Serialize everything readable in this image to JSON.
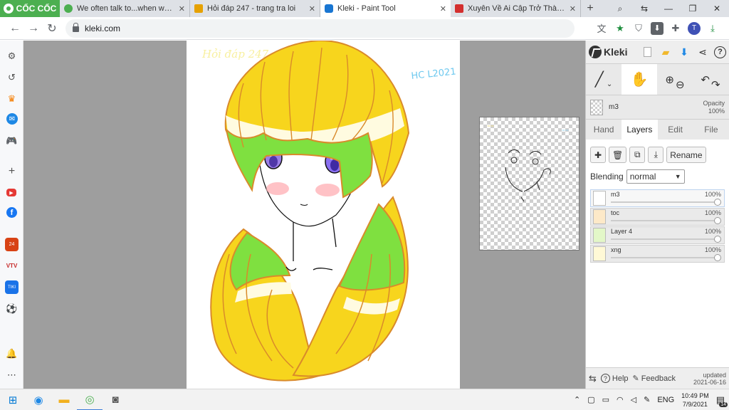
{
  "browser": {
    "brand": "CỐC CỐC",
    "tabs": [
      {
        "title": "We often talk to...when we b",
        "active": false,
        "fav_color": "#4caf50"
      },
      {
        "title": "Hỏi đáp 247 - trang tra loi",
        "active": false,
        "fav_color": "#e6a100"
      },
      {
        "title": "Kleki - Paint Tool",
        "active": true,
        "fav_color": "#1976d2"
      },
      {
        "title": "Xuyên Về Ai Cập Trở Thành S",
        "active": false,
        "fav_color": "#d32f2f"
      }
    ],
    "url": "kleki.com",
    "profile_initial": "T"
  },
  "sidebar": {
    "icons": [
      "gear-icon",
      "history-icon",
      "crown-icon",
      "messenger-icon",
      "gamepad-icon",
      "add-icon",
      "youtube-icon",
      "facebook-icon",
      "news-24h-icon",
      "vtv-icon",
      "tiki-icon",
      "sports-icon",
      "bell-icon",
      "more-icon"
    ]
  },
  "canvas": {
    "signature": "Hỏi đáp 247",
    "watermark": "HC L2021"
  },
  "kleki": {
    "logo": "Kleki",
    "layer_name": "m3",
    "opacity_label": "Opacity",
    "opacity_value": "100%",
    "tabs": [
      "Hand",
      "Layers",
      "Edit",
      "File"
    ],
    "active_tab": "Layers",
    "rename_label": "Rename",
    "blending_label": "Blending",
    "blending_value": "normal",
    "layers": [
      {
        "name": "m3",
        "opacity": "100%",
        "active": true
      },
      {
        "name": "toc",
        "opacity": "100%",
        "active": false
      },
      {
        "name": "Layer 4",
        "opacity": "100%",
        "active": false
      },
      {
        "name": "xng",
        "opacity": "100%",
        "active": false
      }
    ],
    "footer": {
      "help": "Help",
      "feedback": "Feedback",
      "updated_label": "updated",
      "updated_date": "2021-06-16"
    }
  },
  "taskbar": {
    "language": "ENG",
    "time": "10:49 PM",
    "date": "7/9/2021",
    "notification_count": "14"
  },
  "colors": {
    "brand_green": "#4caf50",
    "hair_yellow": "#f7d51d",
    "hair_green": "#7fe040",
    "outline_orange": "#d98a2b"
  }
}
